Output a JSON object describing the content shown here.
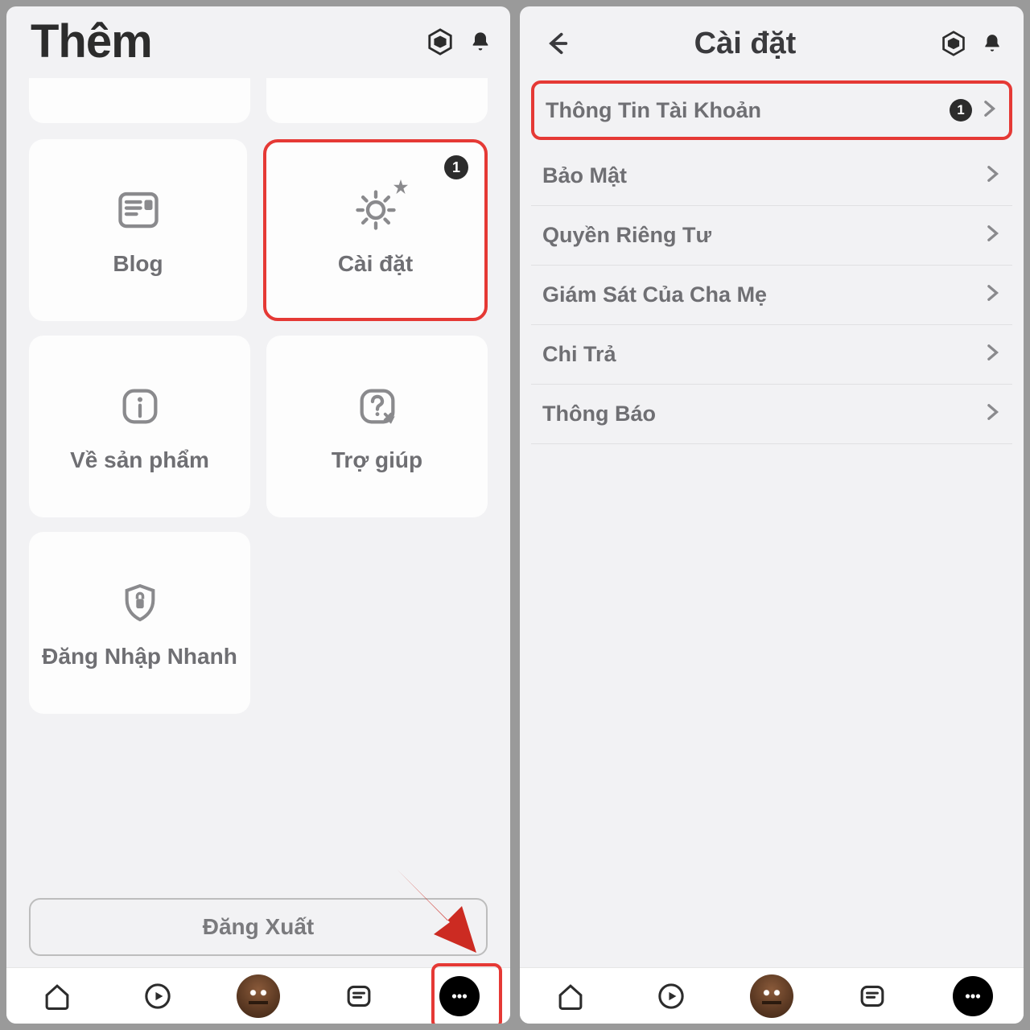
{
  "left": {
    "title": "Thêm",
    "tiles": {
      "blog": "Blog",
      "settings": "Cài đặt",
      "settings_badge": "1",
      "about": "Về sản phẩm",
      "help": "Trợ giúp",
      "quick_login": "Đăng Nhập Nhanh"
    },
    "logout": "Đăng Xuất"
  },
  "right": {
    "title": "Cài đặt",
    "rows": {
      "account": "Thông Tin Tài Khoản",
      "account_badge": "1",
      "security": "Bảo Mật",
      "privacy": "Quyền Riêng Tư",
      "parental": "Giám Sát Của Cha Mẹ",
      "billing": "Chi Trả",
      "notifications": "Thông Báo"
    }
  }
}
